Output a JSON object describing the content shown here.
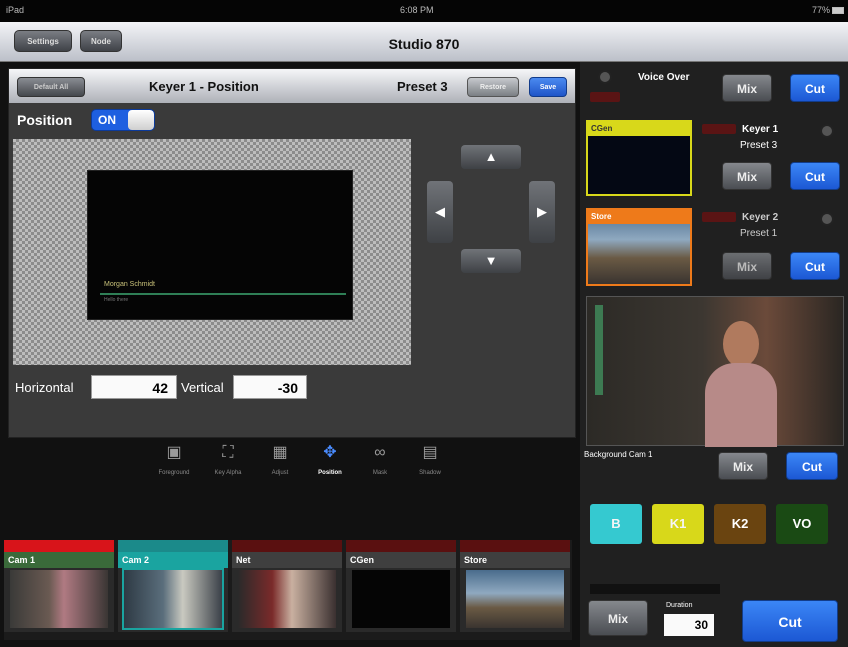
{
  "status_bar": {
    "device": "iPad",
    "time": "6:08 PM",
    "battery": "77%"
  },
  "nav": {
    "settings_label": "Settings",
    "node_label": "Node",
    "title": "Studio 870"
  },
  "keyer": {
    "default_all_label": "Default All",
    "title": "Keyer 1 - Position",
    "preset_label": "Preset 3",
    "restore_label": "Restore",
    "save_label": "Save",
    "position_label": "Position",
    "toggle_on": "ON",
    "lower_third_name": "Morgan Schmidt",
    "lower_third_sub": "Hello there",
    "horizontal_label": "Horizontal",
    "horizontal_value": "42",
    "vertical_label": "Vertical",
    "vertical_value": "-30",
    "arrow_up": "▲",
    "arrow_down": "▼",
    "arrow_left": "◀",
    "arrow_right": "▶"
  },
  "tools": [
    {
      "label": "Foreground",
      "icon": "foreground-icon",
      "glyph": "▣"
    },
    {
      "label": "Key Alpha",
      "icon": "key-alpha-icon",
      "glyph": "⛶"
    },
    {
      "label": "Adjust",
      "icon": "adjust-icon",
      "glyph": "▦"
    },
    {
      "label": "Position",
      "icon": "position-icon",
      "glyph": "✥",
      "active": true
    },
    {
      "label": "Mask",
      "icon": "mask-icon",
      "glyph": "∞"
    },
    {
      "label": "Shadow",
      "icon": "shadow-icon",
      "glyph": "▤"
    }
  ],
  "sources": [
    {
      "name": "Cam 1",
      "tally": "#d8141a",
      "name_bg": "#3a6a3a"
    },
    {
      "name": "Cam 2",
      "tally": "#1b8a8a",
      "name_bg": "#1aa4a0"
    },
    {
      "name": "Net",
      "tally": "#5a1010",
      "name_bg": "#3f3f3f"
    },
    {
      "name": "CGen",
      "tally": "#5a1010",
      "name_bg": "#3f3f3f"
    },
    {
      "name": "Store",
      "tally": "#5a1010",
      "name_bg": "#3f3f3f"
    }
  ],
  "right": {
    "voice_over_label": "Voice Over",
    "mix_label": "Mix",
    "cut_label": "Cut",
    "keyer1_label": "Keyer 1",
    "keyer1_preset": "Preset 3",
    "keyer1_source": "CGen",
    "keyer2_label": "Keyer 2",
    "keyer2_preset": "Preset 1",
    "keyer2_source": "Store",
    "background_label": "Background Cam 1",
    "keys": [
      {
        "label": "B",
        "color": "#35c9d0"
      },
      {
        "label": "K1",
        "color": "#d8d81a"
      },
      {
        "label": "K2",
        "color": "#6a4410"
      },
      {
        "label": "VO",
        "color": "#1a4a14"
      }
    ],
    "duration_label": "Duration",
    "duration_value": "30"
  },
  "colors": {
    "accent_blue": "#1c58d4",
    "keyer1_yellow": "#d8d81a",
    "keyer2_orange": "#ee7a1a"
  }
}
